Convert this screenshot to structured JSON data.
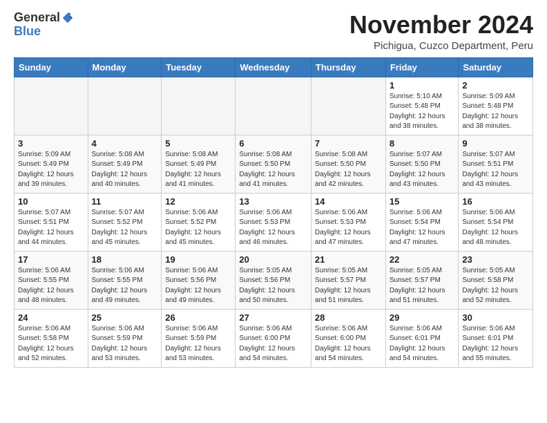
{
  "logo": {
    "general": "General",
    "blue": "Blue"
  },
  "header": {
    "month": "November 2024",
    "location": "Pichigua, Cuzco Department, Peru"
  },
  "weekdays": [
    "Sunday",
    "Monday",
    "Tuesday",
    "Wednesday",
    "Thursday",
    "Friday",
    "Saturday"
  ],
  "weeks": [
    [
      {
        "day": "",
        "info": ""
      },
      {
        "day": "",
        "info": ""
      },
      {
        "day": "",
        "info": ""
      },
      {
        "day": "",
        "info": ""
      },
      {
        "day": "",
        "info": ""
      },
      {
        "day": "1",
        "info": "Sunrise: 5:10 AM\nSunset: 5:48 PM\nDaylight: 12 hours\nand 38 minutes."
      },
      {
        "day": "2",
        "info": "Sunrise: 5:09 AM\nSunset: 5:48 PM\nDaylight: 12 hours\nand 38 minutes."
      }
    ],
    [
      {
        "day": "3",
        "info": "Sunrise: 5:09 AM\nSunset: 5:49 PM\nDaylight: 12 hours\nand 39 minutes."
      },
      {
        "day": "4",
        "info": "Sunrise: 5:08 AM\nSunset: 5:49 PM\nDaylight: 12 hours\nand 40 minutes."
      },
      {
        "day": "5",
        "info": "Sunrise: 5:08 AM\nSunset: 5:49 PM\nDaylight: 12 hours\nand 41 minutes."
      },
      {
        "day": "6",
        "info": "Sunrise: 5:08 AM\nSunset: 5:50 PM\nDaylight: 12 hours\nand 41 minutes."
      },
      {
        "day": "7",
        "info": "Sunrise: 5:08 AM\nSunset: 5:50 PM\nDaylight: 12 hours\nand 42 minutes."
      },
      {
        "day": "8",
        "info": "Sunrise: 5:07 AM\nSunset: 5:50 PM\nDaylight: 12 hours\nand 43 minutes."
      },
      {
        "day": "9",
        "info": "Sunrise: 5:07 AM\nSunset: 5:51 PM\nDaylight: 12 hours\nand 43 minutes."
      }
    ],
    [
      {
        "day": "10",
        "info": "Sunrise: 5:07 AM\nSunset: 5:51 PM\nDaylight: 12 hours\nand 44 minutes."
      },
      {
        "day": "11",
        "info": "Sunrise: 5:07 AM\nSunset: 5:52 PM\nDaylight: 12 hours\nand 45 minutes."
      },
      {
        "day": "12",
        "info": "Sunrise: 5:06 AM\nSunset: 5:52 PM\nDaylight: 12 hours\nand 45 minutes."
      },
      {
        "day": "13",
        "info": "Sunrise: 5:06 AM\nSunset: 5:53 PM\nDaylight: 12 hours\nand 46 minutes."
      },
      {
        "day": "14",
        "info": "Sunrise: 5:06 AM\nSunset: 5:53 PM\nDaylight: 12 hours\nand 47 minutes."
      },
      {
        "day": "15",
        "info": "Sunrise: 5:06 AM\nSunset: 5:54 PM\nDaylight: 12 hours\nand 47 minutes."
      },
      {
        "day": "16",
        "info": "Sunrise: 5:06 AM\nSunset: 5:54 PM\nDaylight: 12 hours\nand 48 minutes."
      }
    ],
    [
      {
        "day": "17",
        "info": "Sunrise: 5:06 AM\nSunset: 5:55 PM\nDaylight: 12 hours\nand 48 minutes."
      },
      {
        "day": "18",
        "info": "Sunrise: 5:06 AM\nSunset: 5:55 PM\nDaylight: 12 hours\nand 49 minutes."
      },
      {
        "day": "19",
        "info": "Sunrise: 5:06 AM\nSunset: 5:56 PM\nDaylight: 12 hours\nand 49 minutes."
      },
      {
        "day": "20",
        "info": "Sunrise: 5:05 AM\nSunset: 5:56 PM\nDaylight: 12 hours\nand 50 minutes."
      },
      {
        "day": "21",
        "info": "Sunrise: 5:05 AM\nSunset: 5:57 PM\nDaylight: 12 hours\nand 51 minutes."
      },
      {
        "day": "22",
        "info": "Sunrise: 5:05 AM\nSunset: 5:57 PM\nDaylight: 12 hours\nand 51 minutes."
      },
      {
        "day": "23",
        "info": "Sunrise: 5:05 AM\nSunset: 5:58 PM\nDaylight: 12 hours\nand 52 minutes."
      }
    ],
    [
      {
        "day": "24",
        "info": "Sunrise: 5:06 AM\nSunset: 5:58 PM\nDaylight: 12 hours\nand 52 minutes."
      },
      {
        "day": "25",
        "info": "Sunrise: 5:06 AM\nSunset: 5:59 PM\nDaylight: 12 hours\nand 53 minutes."
      },
      {
        "day": "26",
        "info": "Sunrise: 5:06 AM\nSunset: 5:59 PM\nDaylight: 12 hours\nand 53 minutes."
      },
      {
        "day": "27",
        "info": "Sunrise: 5:06 AM\nSunset: 6:00 PM\nDaylight: 12 hours\nand 54 minutes."
      },
      {
        "day": "28",
        "info": "Sunrise: 5:06 AM\nSunset: 6:00 PM\nDaylight: 12 hours\nand 54 minutes."
      },
      {
        "day": "29",
        "info": "Sunrise: 5:06 AM\nSunset: 6:01 PM\nDaylight: 12 hours\nand 54 minutes."
      },
      {
        "day": "30",
        "info": "Sunrise: 5:06 AM\nSunset: 6:01 PM\nDaylight: 12 hours\nand 55 minutes."
      }
    ]
  ]
}
